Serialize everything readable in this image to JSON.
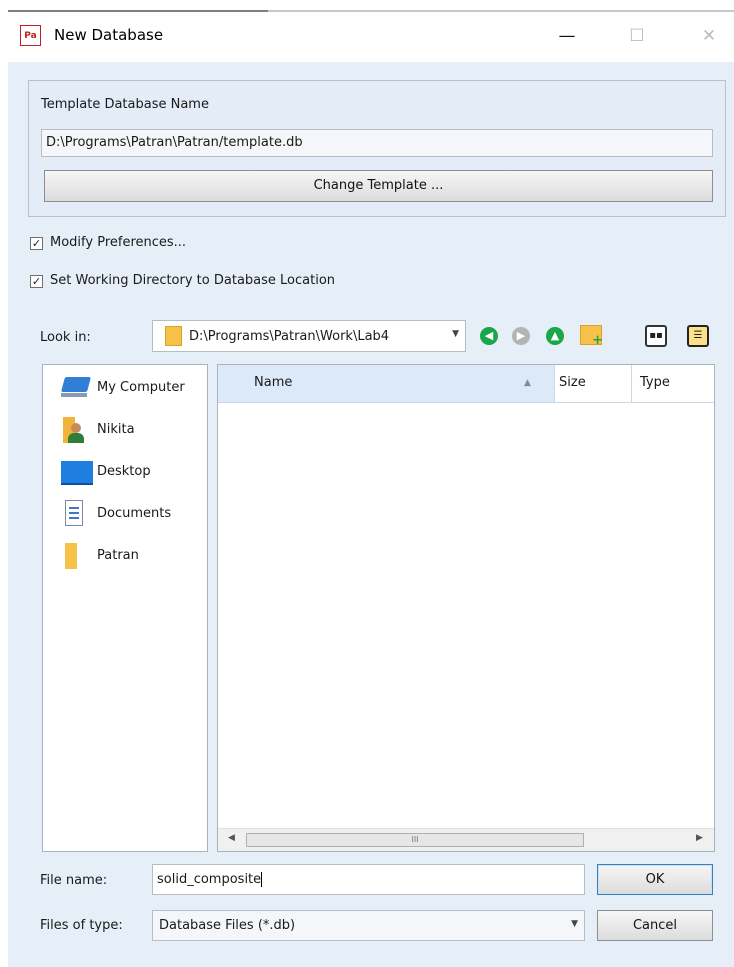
{
  "window": {
    "title": "New Database",
    "app_icon_text": "Pa",
    "minimize_glyph": "—",
    "maximize_glyph": "☐",
    "close_glyph": "✕"
  },
  "template": {
    "label": "Template Database Name",
    "path": "D:\\Programs\\Patran\\Patran/template.db",
    "change_button": "Change Template ..."
  },
  "options": {
    "modify_preferences": {
      "label": "Modify Preferences...",
      "checked": true
    },
    "set_working_directory": {
      "label": "Set Working Directory to Database Location",
      "checked": true
    },
    "check_glyph": "✓"
  },
  "look_in": {
    "label": "Look in:",
    "path": "D:\\Programs\\Patran\\Work\\Lab4",
    "toolbar_icons": [
      "back-icon",
      "forward-icon",
      "up-folder-icon",
      "new-folder-icon",
      "list-view-icon",
      "detail-view-icon"
    ]
  },
  "places": [
    {
      "label": "My Computer",
      "icon": "computer-icon"
    },
    {
      "label": "Nikita",
      "icon": "user-icon"
    },
    {
      "label": "Desktop",
      "icon": "desktop-icon"
    },
    {
      "label": "Documents",
      "icon": "documents-icon"
    },
    {
      "label": "Patran",
      "icon": "folder-icon"
    }
  ],
  "file_list": {
    "columns": [
      "Name",
      "Size",
      "Type"
    ],
    "sorted_column": "Name",
    "sort_glyph": "▲",
    "rows": []
  },
  "scrollbar": {
    "left_glyph": "◀",
    "right_glyph": "▶",
    "thumb_grip": "III"
  },
  "file_name": {
    "label": "File name:",
    "value": "solid_composite"
  },
  "file_type": {
    "label": "Files of type:",
    "value": "Database Files (*.db)"
  },
  "buttons": {
    "ok": "OK",
    "cancel": "Cancel"
  },
  "colors": {
    "client_bg": "#e6eef8",
    "accent": "#3c7fb1",
    "nav_green": "#1aa64a",
    "folder": "#f7c24a"
  }
}
